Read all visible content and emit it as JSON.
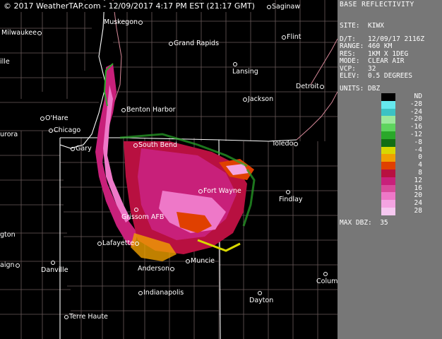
{
  "timestamp": "© 2017 WeatherTAP.com - 12/09/2017  4:17 PM EST (21:17 GMT)",
  "panel": {
    "title": "BASE REFLECTIVITY",
    "site": "SITE:  KIWX",
    "info": [
      "D/T:   12/09/17 2116Z",
      "RANGE: 460 KM",
      "RES:   1KM X 1DEG",
      "MODE:  CLEAR AIR",
      "VCP:   32",
      "ELEV:  0.5 DEGREES"
    ],
    "units": "UNITS: DBZ",
    "scale": [
      {
        "label": "ND",
        "color": "#000000"
      },
      {
        "label": "-28",
        "color": "#66e8ee"
      },
      {
        "label": "-24",
        "color": "#3cc2c4"
      },
      {
        "label": "-20",
        "color": "#9be89b"
      },
      {
        "label": "-16",
        "color": "#5ed45e"
      },
      {
        "label": "-12",
        "color": "#2aa82a"
      },
      {
        "label": "-8",
        "color": "#136e13"
      },
      {
        "label": "-4",
        "color": "#d8d800"
      },
      {
        "label": "0",
        "color": "#f0a000"
      },
      {
        "label": "4",
        "color": "#e04000"
      },
      {
        "label": "8",
        "color": "#b81040"
      },
      {
        "label": "12",
        "color": "#c8207a"
      },
      {
        "label": "16",
        "color": "#d84a9a"
      },
      {
        "label": "20",
        "color": "#ee78c8"
      },
      {
        "label": "24",
        "color": "#f4a4e2"
      },
      {
        "label": "28",
        "color": "#f6c8f0"
      }
    ],
    "max_dbz": "MAX DBZ:  35"
  },
  "cities": [
    {
      "name": "Saginaw",
      "dot": "before"
    },
    {
      "name": "Muskegon",
      "dot": "after"
    },
    {
      "name": "Milwaukee",
      "dot": "after"
    },
    {
      "name": "Grand Rapids",
      "dot": "before"
    },
    {
      "name": "Flint",
      "dot": "before"
    },
    {
      "name": "ille",
      "dot": "none"
    },
    {
      "name": "Lansing",
      "dot": "before"
    },
    {
      "name": "Detroit",
      "dot": "after"
    },
    {
      "name": "Jackson",
      "dot": "before"
    },
    {
      "name": "Benton Harbor",
      "dot": "before"
    },
    {
      "name": "O'Hare",
      "dot": "before"
    },
    {
      "name": "Chicago",
      "dot": "before"
    },
    {
      "name": "urora",
      "dot": "none"
    },
    {
      "name": "Gary",
      "dot": "before"
    },
    {
      "name": "South Bend",
      "dot": "before"
    },
    {
      "name": "Toledo",
      "dot": "after"
    },
    {
      "name": "Fort Wayne",
      "dot": "before"
    },
    {
      "name": "Findlay",
      "dot": "above"
    },
    {
      "name": "Grissom AFB",
      "dot": "above"
    },
    {
      "name": "gton",
      "dot": "none"
    },
    {
      "name": "Lafayette",
      "dot": "after"
    },
    {
      "name": "aign",
      "dot": "after"
    },
    {
      "name": "Danville",
      "dot": "above"
    },
    {
      "name": "Anderson",
      "dot": "after"
    },
    {
      "name": "Muncie",
      "dot": "before"
    },
    {
      "name": "Columbu",
      "dot": "above"
    },
    {
      "name": "Indianapolis",
      "dot": "before"
    },
    {
      "name": "Dayton",
      "dot": "above"
    },
    {
      "name": "Terre Haute",
      "dot": "before"
    }
  ]
}
